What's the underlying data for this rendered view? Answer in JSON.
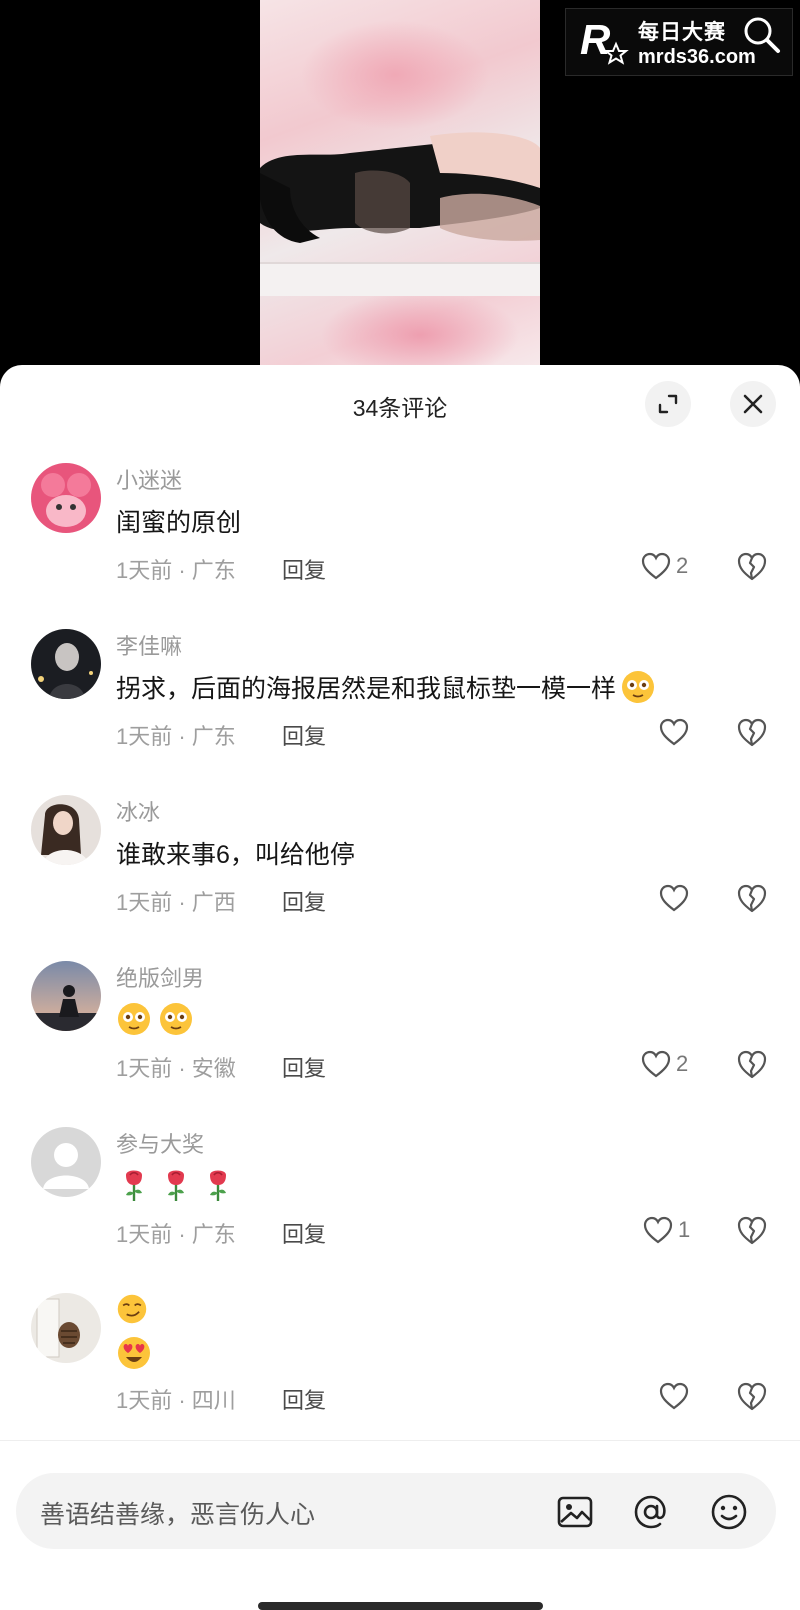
{
  "watermark": {
    "line1": "每日大赛",
    "line2": "mrds36.com"
  },
  "sheet": {
    "title": "34条评论"
  },
  "comments": [
    {
      "name": "小迷迷",
      "text": "闺蜜的原创",
      "emojis": [],
      "meta": "1天前 · 广东",
      "reply": "回复",
      "likes": "2"
    },
    {
      "name": "李佳嘛",
      "text": "拐求，后面的海报居然是和我鼠标垫一模一样",
      "emojis": [
        "flushed-emoji"
      ],
      "meta": "1天前 · 广东",
      "reply": "回复",
      "likes": ""
    },
    {
      "name": "冰冰",
      "text": "谁敢来事6，叫给他停",
      "emojis": [],
      "meta": "1天前 · 广西",
      "reply": "回复",
      "likes": ""
    },
    {
      "name": "绝版剑男",
      "text": "",
      "emojis": [
        "flushed-emoji",
        "flushed-emoji"
      ],
      "meta": "1天前 · 安徽",
      "reply": "回复",
      "likes": "2"
    },
    {
      "name": "参与大奖",
      "text": "",
      "emojis": [
        "rose-emoji",
        "rose-emoji",
        "rose-emoji"
      ],
      "meta": "1天前 · 广东",
      "reply": "回复",
      "likes": "1"
    },
    {
      "name": "",
      "text": "",
      "emojis": [
        "smirk-emoji",
        "heart-eyes-emoji"
      ],
      "meta": "1天前 · 四川",
      "reply": "回复",
      "likes": ""
    }
  ],
  "input": {
    "placeholder": "善语结善缘，恶言伤人心"
  }
}
